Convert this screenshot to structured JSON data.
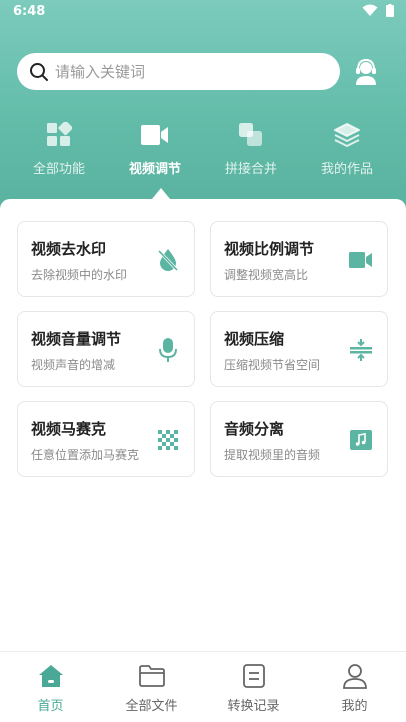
{
  "status_bar": {
    "time": "6:48"
  },
  "search": {
    "placeholder": "请输入关键词"
  },
  "tabs": [
    {
      "label": "全部功能",
      "icon": "grid-icon",
      "active": false
    },
    {
      "label": "视频调节",
      "icon": "video-camera-icon",
      "active": true
    },
    {
      "label": "拼接合并",
      "icon": "merge-icon",
      "active": false
    },
    {
      "label": "我的作品",
      "icon": "layers-icon",
      "active": false
    }
  ],
  "features": [
    {
      "title": "视频去水印",
      "desc": "去除视频中的水印",
      "icon": "no-watermark-icon"
    },
    {
      "title": "视频比例调节",
      "desc": "调整视频宽高比",
      "icon": "video-camera-icon"
    },
    {
      "title": "视频音量调节",
      "desc": "视频声音的增减",
      "icon": "microphone-icon"
    },
    {
      "title": "视频压缩",
      "desc": "压缩视频节省空间",
      "icon": "compress-icon"
    },
    {
      "title": "视频马赛克",
      "desc": "任意位置添加马赛克",
      "icon": "mosaic-icon"
    },
    {
      "title": "音频分离",
      "desc": "提取视频里的音频",
      "icon": "music-note-icon"
    }
  ],
  "bottom_nav": [
    {
      "label": "首页",
      "icon": "home-icon",
      "active": true
    },
    {
      "label": "全部文件",
      "icon": "folder-icon",
      "active": false
    },
    {
      "label": "转换记录",
      "icon": "record-icon",
      "active": false
    },
    {
      "label": "我的",
      "icon": "user-icon",
      "active": false
    }
  ],
  "colors": {
    "accent": "#4aa996",
    "header_top": "#7ccbbd",
    "header_bottom": "#58b29f"
  }
}
